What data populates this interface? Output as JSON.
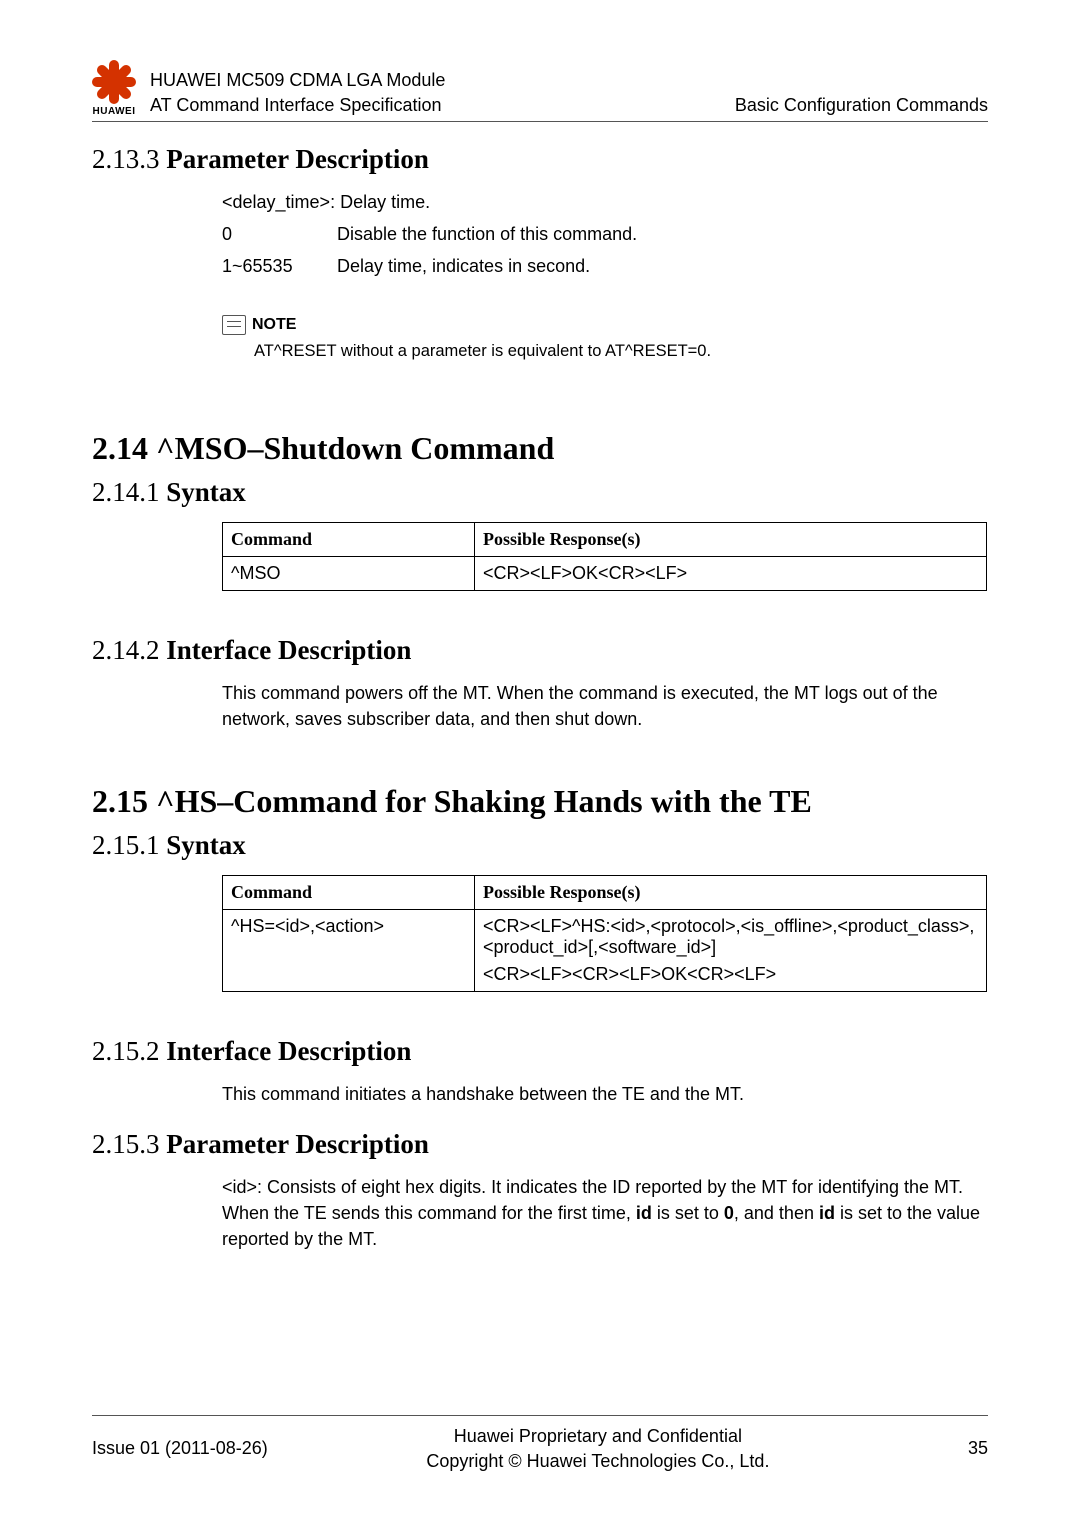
{
  "header": {
    "logo_text": "HUAWEI",
    "title_line1": "HUAWEI MC509 CDMA LGA Module",
    "title_line2": "AT Command Interface Specification",
    "right": "Basic Configuration Commands"
  },
  "s2133": {
    "num": "2.13.3",
    "title": "Parameter Description",
    "delay_line": "<delay_time>: Delay time.",
    "row0_key": "0",
    "row0_val": "Disable the function of this command.",
    "row1_key": "1~65535",
    "row1_val": "Delay time, indicates in second.",
    "note_label": "NOTE",
    "note_text": "AT^RESET without a parameter is equivalent to AT^RESET=0."
  },
  "s214": {
    "heading": "2.14 ^MSO–Shutdown Command"
  },
  "s2141": {
    "num": "2.14.1",
    "title": "Syntax",
    "th_cmd": "Command",
    "th_resp": "Possible Response(s)",
    "cmd": "^MSO",
    "resp": "<CR><LF>OK<CR><LF>"
  },
  "s2142": {
    "num": "2.14.2",
    "title": "Interface Description",
    "text": "This command powers off the MT. When the command is executed, the MT logs out of the network, saves subscriber data, and then shut down."
  },
  "s215": {
    "heading": "2.15 ^HS–Command for Shaking Hands with the TE"
  },
  "s2151": {
    "num": "2.15.1",
    "title": "Syntax",
    "th_cmd": "Command",
    "th_resp": "Possible Response(s)",
    "cmd": "^HS=<id>,<action>",
    "resp_l1": "<CR><LF>^HS:<id>,<protocol>,<is_offline>,<product_class>,<product_id>[,<software_id>]",
    "resp_l2": "<CR><LF><CR><LF>OK<CR><LF>"
  },
  "s2152": {
    "num": "2.15.2",
    "title": "Interface Description",
    "text": "This command initiates a handshake between the TE and the MT."
  },
  "s2153": {
    "num": "2.15.3",
    "title": "Parameter Description",
    "p_pre": "<id>: Consists of eight hex digits. It indicates the ID reported by the MT for identifying the MT. When the TE sends this command for the first time, ",
    "p_b1": "id",
    "p_mid1": " is set to ",
    "p_b2": "0",
    "p_mid2": ", and then ",
    "p_b3": "id",
    "p_post": " is set to the value reported by the MT."
  },
  "footer": {
    "left": "Issue 01 (2011-08-26)",
    "center_l1": "Huawei Proprietary and Confidential",
    "center_l2": "Copyright © Huawei Technologies Co., Ltd.",
    "page": "35"
  }
}
